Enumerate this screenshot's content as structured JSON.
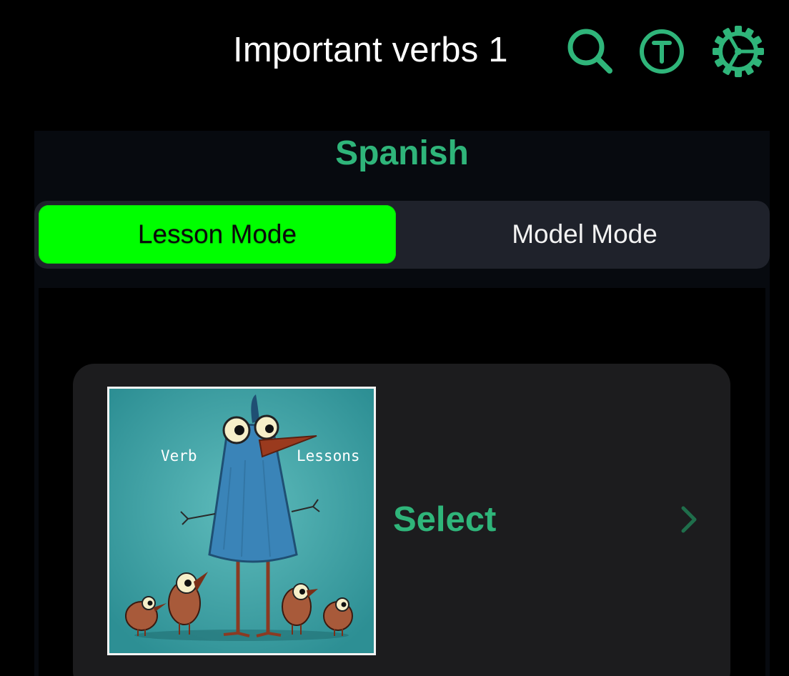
{
  "header": {
    "title": "Important verbs 1",
    "icons": {
      "search": "search-icon",
      "translate": "t-circle-icon",
      "settings": "gear-icon"
    }
  },
  "panel": {
    "title": "Spanish",
    "modes": [
      {
        "label": "Lesson Mode",
        "selected": true
      },
      {
        "label": "Model Mode",
        "selected": false
      }
    ]
  },
  "card": {
    "image": {
      "description_icon": "bird-illustration",
      "overlay_words": [
        "Verb",
        "Lessons"
      ]
    },
    "action_label": "Select",
    "chevron_icon": "chevron-right-icon"
  },
  "colors": {
    "accent_green": "#2fb57a",
    "selected_bright_green": "#00ff00",
    "background": "#000000",
    "segment_bg": "#1f222b",
    "card_bg": "#1c1c1e",
    "thumb_teal": "#3aa3a8"
  }
}
